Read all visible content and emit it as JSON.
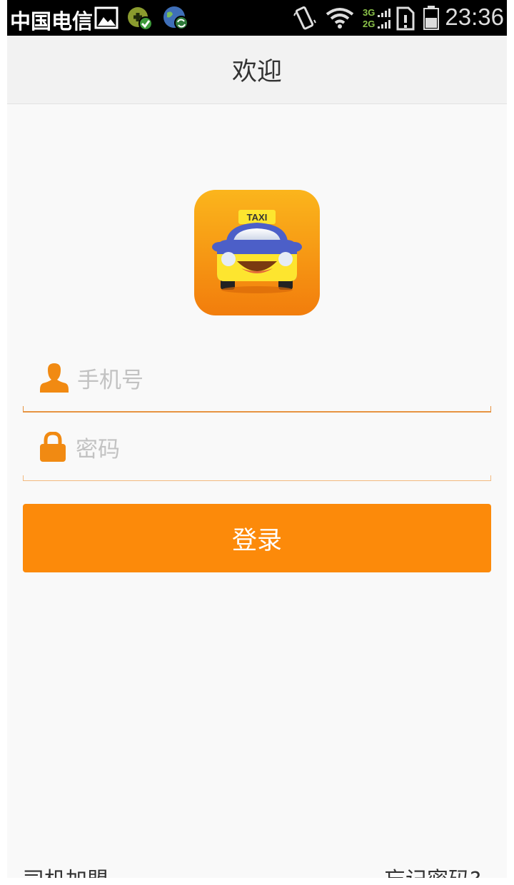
{
  "status_bar": {
    "carrier": "中国电信",
    "network_top": "3G",
    "network_bottom": "2G",
    "time": "23:36",
    "icons": [
      "image-icon",
      "app-update-icon",
      "globe-sync-icon",
      "vibrate-icon",
      "wifi-icon",
      "signal-icon",
      "sim-alert-icon",
      "battery-icon"
    ]
  },
  "header": {
    "title": "欢迎"
  },
  "logo": {
    "sign_text": "TAXI",
    "icon": "taxi-app-icon"
  },
  "form": {
    "phone_placeholder": "手机号",
    "phone_value": "",
    "password_placeholder": "密码",
    "password_value": "",
    "phone_icon": "user-icon",
    "password_icon": "lock-icon",
    "login_label": "登录"
  },
  "footer": {
    "driver_join": "司机加盟",
    "forgot_password": "忘记密码?"
  },
  "colors": {
    "accent": "#fc8a0a",
    "field_underline": "#e79341",
    "title_bar": "#f2f2f2",
    "background": "#f9f9f9"
  }
}
